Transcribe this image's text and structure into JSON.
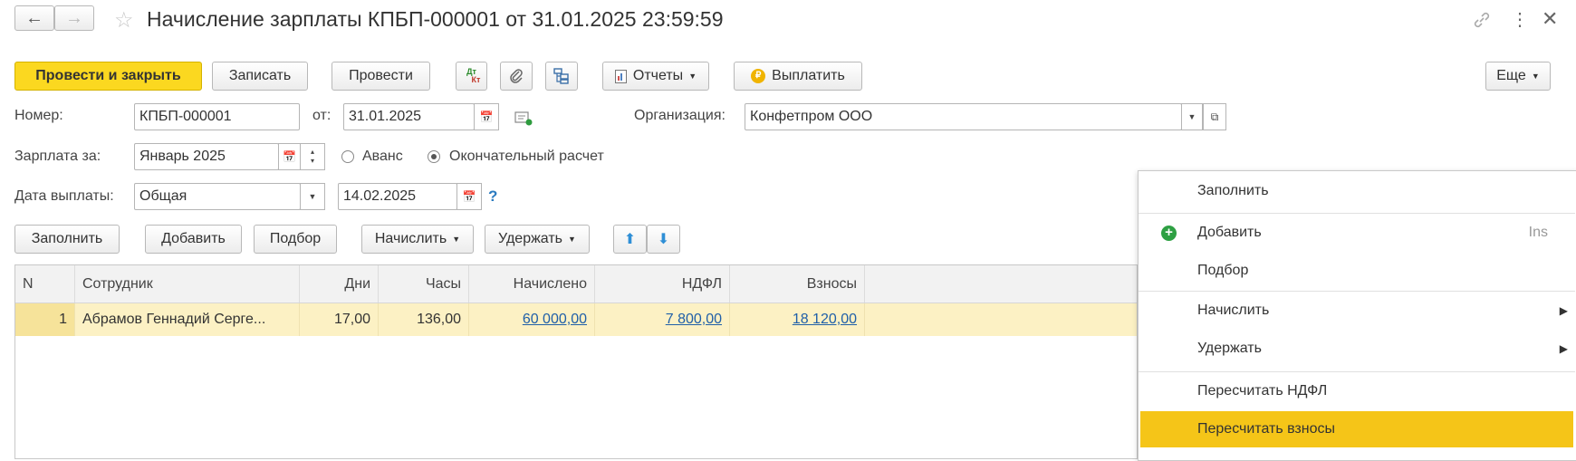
{
  "header": {
    "title": "Начисление зарплаты КПБП-000001 от 31.01.2025 23:59:59"
  },
  "toolbar": {
    "post_close": "Провести и закрыть",
    "save": "Записать",
    "post": "Провести",
    "dtkt_top": "Дт",
    "dtkt_bottom": "Кт",
    "reports": "Отчеты",
    "pay": "Выплатить",
    "more": "Еще"
  },
  "form": {
    "number_label": "Номер:",
    "number_value": "КПБП-000001",
    "from_label": "от:",
    "date_value": "31.01.2025",
    "org_label": "Организация:",
    "org_value": "Конфетпром ООО",
    "salary_for_label": "Зарплата за:",
    "salary_for_value": "Январь 2025",
    "advance_label": "Аванс",
    "final_label": "Окончательный расчет",
    "pay_date_label": "Дата выплаты:",
    "pay_type_value": "Общая",
    "pay_date_value": "14.02.2025",
    "help": "?"
  },
  "table_toolbar": {
    "fill": "Заполнить",
    "add": "Добавить",
    "select": "Подбор",
    "accrue": "Начислить",
    "withhold": "Удержать"
  },
  "table": {
    "columns": [
      "N",
      "Сотрудник",
      "Дни",
      "Часы",
      "Начислено",
      "НДФЛ",
      "Взносы"
    ],
    "rows": [
      {
        "n": "1",
        "employee": "Абрамов Геннадий Серге...",
        "days": "17,00",
        "hours": "136,00",
        "accrued": "60 000,00",
        "ndfl": "7 800,00",
        "contrib": "18 120,00"
      }
    ]
  },
  "context_menu": {
    "items": [
      {
        "label": "Заполнить"
      },
      {
        "label": "Добавить",
        "shortcut": "Ins"
      },
      {
        "label": "Подбор"
      },
      {
        "label": "Начислить"
      },
      {
        "label": "Удержать"
      },
      {
        "label": "Пересчитать НДФЛ"
      },
      {
        "label": "Пересчитать взносы"
      }
    ]
  },
  "colors": {
    "accent_yellow": "#fbd820",
    "selected_row": "#fcf1c4",
    "menu_highlight": "#f5c518",
    "link": "#1f5fa8"
  }
}
